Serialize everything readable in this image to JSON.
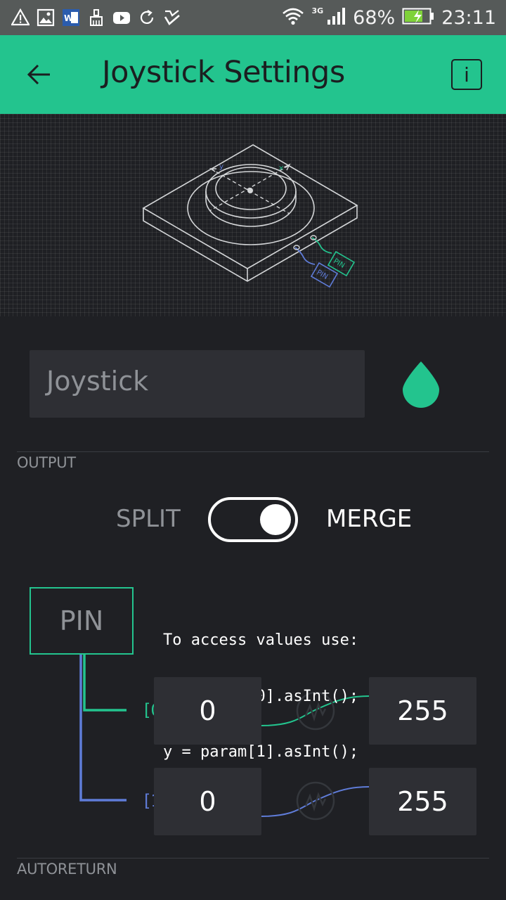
{
  "status_bar": {
    "icons_left": [
      "warning-icon",
      "image-icon",
      "word-doc-icon",
      "cleaner-icon",
      "youtube-icon",
      "sync-icon",
      "check-icon"
    ],
    "network": "3G",
    "battery": "68%",
    "time": "23:11"
  },
  "app_bar": {
    "title": "Joystick Settings",
    "back_icon": "back-arrow-icon",
    "info_label": "i"
  },
  "widget": {
    "name_value": "Joystick",
    "color": "#23c48e"
  },
  "output": {
    "section_label": "OUTPUT",
    "split_label": "SPLIT",
    "merge_label": "MERGE",
    "merge_enabled": true,
    "pin_label": "PIN",
    "hint_lines": [
      "To access values use:",
      "x = param[0].asInt();",
      "y = param[1].asInt();"
    ],
    "channels": [
      {
        "index_label": "[0]",
        "min": "0",
        "max": "255",
        "color": "#23c48e"
      },
      {
        "index_label": "[1]",
        "min": "0",
        "max": "255",
        "color": "#5f7cd8"
      }
    ]
  },
  "autoreturn": {
    "section_label": "AUTORETURN"
  },
  "colors": {
    "accent": "#23c48e",
    "secondary": "#5f7cd8",
    "background": "#1f2024",
    "field": "#2e2f34"
  }
}
